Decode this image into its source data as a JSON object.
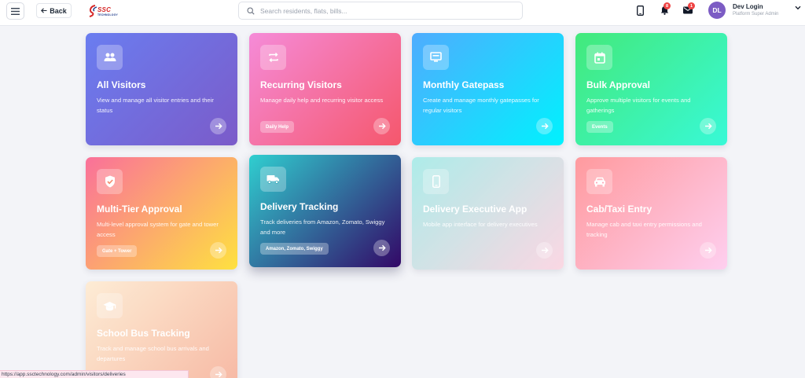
{
  "header": {
    "back_label": "Back",
    "logo_text": "SSC",
    "logo_sub": "TECHNOLOGY",
    "search_placeholder": "Search residents, flats, bills...",
    "notification_count": "8",
    "message_count": "1",
    "user": {
      "initials": "DL",
      "name": "Dev Login",
      "role": "Platform Super Admin"
    }
  },
  "cards": [
    {
      "title": "All Visitors",
      "description": "View and manage all visitor entries and their status",
      "tag": "",
      "icon": "users-icon",
      "gradient": [
        "#6a7df0",
        "#7b5bc9"
      ]
    },
    {
      "title": "Recurring Visitors",
      "description": "Manage daily help and recurring visitor access",
      "tag": "Daily Help",
      "icon": "repeat-icon",
      "gradient": [
        "#f58bd8",
        "#f5576c"
      ]
    },
    {
      "title": "Monthly Gatepass",
      "description": "Create and manage monthly gatepasses for regular visitors",
      "tag": "",
      "icon": "monitor-icon",
      "gradient": [
        "#4facfe",
        "#00f2fe"
      ]
    },
    {
      "title": "Bulk Approval",
      "description": "Approve multiple visitors for events and gatherings",
      "tag": "Events",
      "icon": "calendar-icon",
      "gradient": [
        "#43e97b",
        "#38f9d7"
      ]
    },
    {
      "title": "Multi-Tier Approval",
      "description": "Multi-level approval system for gate and tower access",
      "tag": "Gate + Tower",
      "icon": "shield-check-icon",
      "gradient": [
        "#fa709a",
        "#fee140"
      ]
    },
    {
      "title": "Delivery Tracking",
      "description": "Track deliveries from Amazon, Zomato, Swiggy and more",
      "tag": "Amazon, Zomato, Swiggy",
      "icon": "truck-icon",
      "gradient": [
        "#30cfd0",
        "#330867"
      ]
    },
    {
      "title": "Delivery Executive App",
      "description": "Mobile app interface for delivery executives",
      "tag": "",
      "icon": "phone-icon",
      "gradient": [
        "#a8edea",
        "#fed6e3"
      ]
    },
    {
      "title": "Cab/Taxi Entry",
      "description": "Manage cab and taxi entry permissions and tracking",
      "tag": "",
      "icon": "car-icon",
      "gradient": [
        "#ff9a9e",
        "#fecfef"
      ]
    },
    {
      "title": "School Bus Tracking",
      "description": "Track and manage school bus arrivals and departures",
      "tag": "",
      "icon": "graduation-cap-icon",
      "gradient": [
        "#ffecd2",
        "#fcb69f"
      ]
    }
  ],
  "status_bar_url": "https://app.ssctechnology.com/admin/visitors/deliveries"
}
